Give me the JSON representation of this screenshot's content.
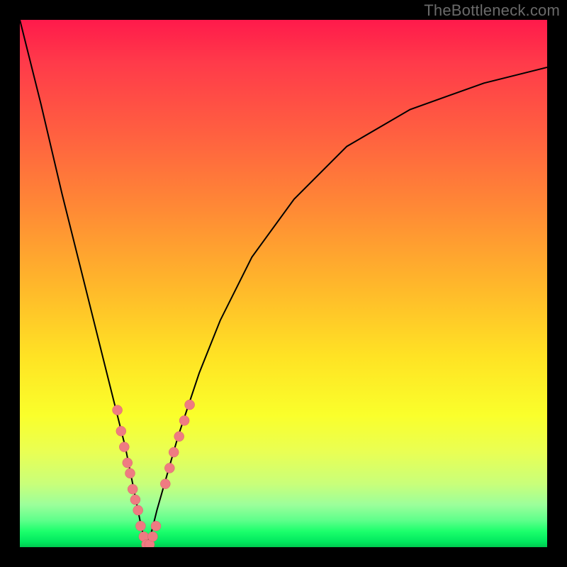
{
  "watermark": "TheBottleneck.com",
  "colors": {
    "frame": "#000000",
    "curve": "#000000",
    "dot_fill": "#ef7b82",
    "dot_stroke": "#d9636b"
  },
  "chart_data": {
    "type": "line",
    "title": "",
    "xlabel": "",
    "ylabel": "",
    "xlim": [
      0,
      100
    ],
    "ylim": [
      0,
      100
    ],
    "grid": false,
    "legend": false,
    "note": "Bottleneck-style absolute-value curve. y is the mismatch/bottleneck percentage; minimum (y≈0) near x≈24. No axis ticks or numeric labels are rendered in the image; x-values are relative positions along the horizontal axis.",
    "series": [
      {
        "name": "bottleneck_curve",
        "x": [
          0,
          4,
          8,
          12,
          16,
          18,
          20,
          22,
          23,
          24,
          25,
          26,
          28,
          30,
          34,
          38,
          44,
          52,
          62,
          74,
          88,
          100
        ],
        "y": [
          100,
          84,
          67,
          51,
          35,
          27,
          19,
          9,
          4,
          0,
          3,
          7,
          14,
          21,
          33,
          43,
          55,
          66,
          76,
          83,
          88,
          91
        ]
      }
    ],
    "data_points_overlay": {
      "name": "sample_dots",
      "note": "Pink dots clustered near the curve minimum on both branches.",
      "points": [
        {
          "x": 18.5,
          "y": 26
        },
        {
          "x": 19.2,
          "y": 22
        },
        {
          "x": 19.8,
          "y": 19
        },
        {
          "x": 20.4,
          "y": 16
        },
        {
          "x": 20.9,
          "y": 14
        },
        {
          "x": 21.4,
          "y": 11
        },
        {
          "x": 21.9,
          "y": 9
        },
        {
          "x": 22.4,
          "y": 7
        },
        {
          "x": 22.9,
          "y": 4
        },
        {
          "x": 23.5,
          "y": 2
        },
        {
          "x": 24.0,
          "y": 0.5
        },
        {
          "x": 24.6,
          "y": 0.5
        },
        {
          "x": 25.2,
          "y": 2
        },
        {
          "x": 25.8,
          "y": 4
        },
        {
          "x": 27.6,
          "y": 12
        },
        {
          "x": 28.4,
          "y": 15
        },
        {
          "x": 29.2,
          "y": 18
        },
        {
          "x": 30.2,
          "y": 21
        },
        {
          "x": 31.2,
          "y": 24
        },
        {
          "x": 32.2,
          "y": 27
        }
      ]
    }
  }
}
